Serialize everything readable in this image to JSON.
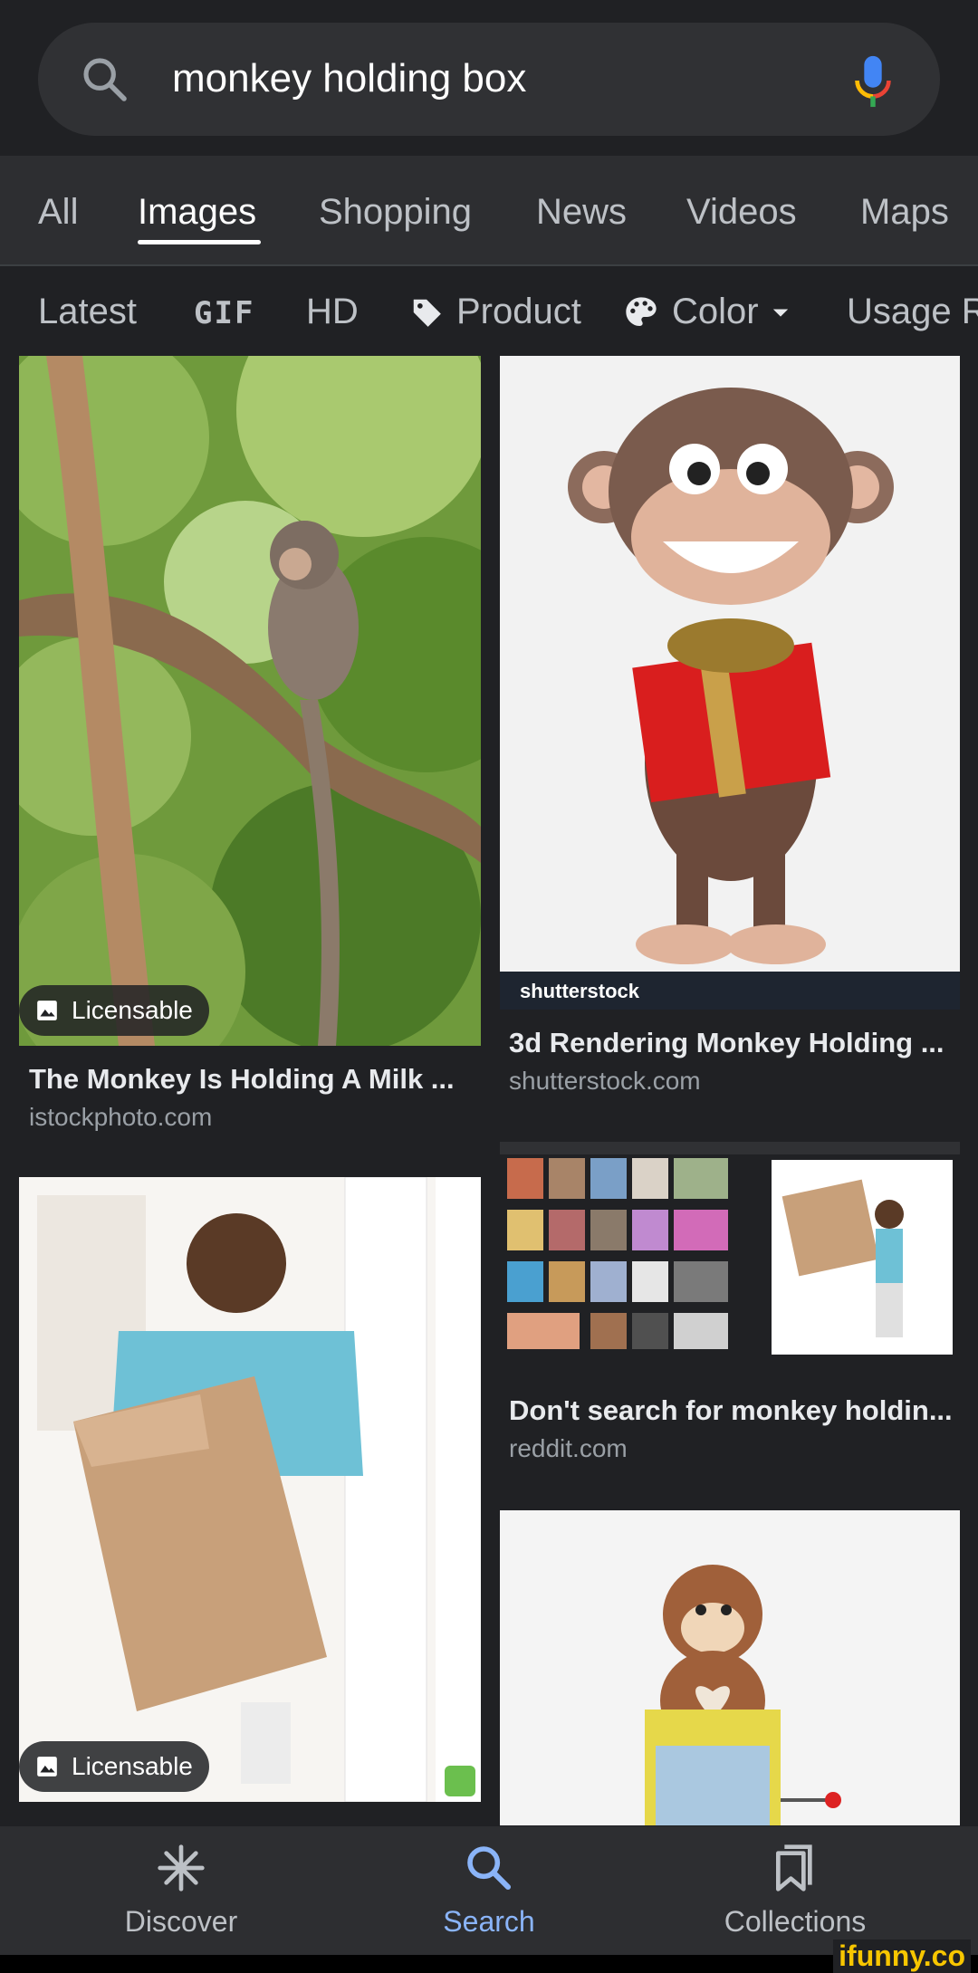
{
  "search": {
    "query": "monkey holding box"
  },
  "tabs": [
    "All",
    "Images",
    "Shopping",
    "News",
    "Videos",
    "Maps"
  ],
  "active_tab": "Images",
  "filters": {
    "latest": "Latest",
    "gif": "GIF",
    "hd": "HD",
    "product": "Product",
    "color": "Color",
    "usage": "Usage R"
  },
  "results": [
    {
      "title": "The Monkey Is Holding A Milk ...",
      "source": "istockphoto.com",
      "badge": "Licensable"
    },
    {
      "title": "3d Rendering Monkey Holding ...",
      "source": "shutterstock.com",
      "watermark": "shutterstock"
    },
    {
      "title": "Don't search for monkey holdin...",
      "source": "reddit.com"
    },
    {
      "badge": "Licensable"
    },
    {}
  ],
  "nav": {
    "discover": "Discover",
    "search": "Search",
    "collections": "Collections"
  },
  "brand": {
    "watermark": "ifunny.co"
  },
  "colors": {
    "background": "#202124",
    "accent": "#8ab4f8",
    "surface": "#303134"
  }
}
